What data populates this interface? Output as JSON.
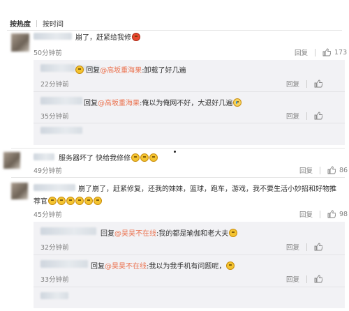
{
  "tabs": {
    "hot": "按热度",
    "time": "按时间"
  },
  "comments": [
    {
      "text": "崩了，赶紧给我修",
      "time": "50分钟前",
      "reply": "回复",
      "likes": "173"
    },
    {
      "text": "服务器坏了 快给我修修",
      "time": "49分钟前",
      "reply": "回复",
      "likes": "86"
    },
    {
      "text_line1": "崩了崩了，赶紧修复，还我的妹妹，篮球，跑车，游戏，我不要生活小妙招和好物推",
      "text_line2": "荐官",
      "time": "45分钟前",
      "reply": "回复",
      "likes": "98"
    }
  ],
  "replies_a": [
    {
      "prefix": "回复",
      "mention": "@高坂重海果",
      "text": ":卸载了好几遍",
      "time": "22分钟前",
      "reply": "回复"
    },
    {
      "prefix": "回复",
      "mention": "@高坂重海果",
      "text": ":俺以为俺网不好，大退好几遍",
      "time": "35分钟前",
      "reply": "回复"
    }
  ],
  "replies_b": [
    {
      "prefix": "回复",
      "mention": "@昊昊不在线",
      "text": ":我的都是瑜伽和老大夫",
      "time": "32分钟前",
      "reply": "回复"
    },
    {
      "prefix": "回复",
      "mention": "@昊昊不在线",
      "text": ":我以为我手机有问题呢，",
      "time": "33分钟前",
      "reply": "回复"
    }
  ],
  "icons": {
    "like": "thumbs-up-icon",
    "emoji": "face-emoji-icon"
  },
  "colors": {
    "link": "#eb7350",
    "meta": "#808080",
    "reply_bg": "#f2f2f5"
  }
}
